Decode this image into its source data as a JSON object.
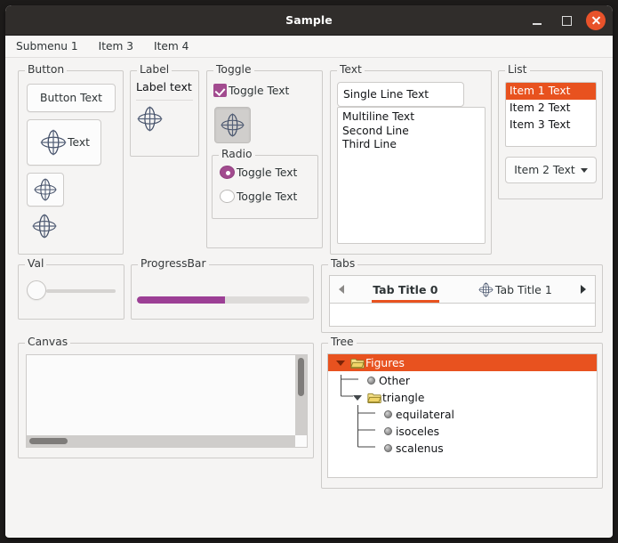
{
  "window": {
    "title": "Sample",
    "controls": {
      "minimize": "minimize",
      "maximize": "maximize",
      "close": "close"
    }
  },
  "menubar": {
    "items": [
      {
        "label": "Submenu 1"
      },
      {
        "label": "Item 3"
      },
      {
        "label": "Item 4"
      }
    ]
  },
  "colors": {
    "accent_orange": "#e8521f",
    "accent_purple": "#9c3f95",
    "checkbox_purple": "#a24b8f",
    "titlebar_bg": "#302d2b",
    "window_bg": "#f5f4f3",
    "border": "#cdcbc9",
    "folder_yellow": "#f2d86a"
  },
  "groups": {
    "button": {
      "legend": "Button",
      "buttons": [
        {
          "label": "Button Text",
          "icon": ""
        },
        {
          "label": "Text",
          "icon": "gyroscope-icon"
        },
        {
          "label": "",
          "icon": "gyroscope-icon"
        }
      ],
      "bare_icon": "gyroscope-icon"
    },
    "label": {
      "legend": "Label",
      "text": "Label text",
      "icon": "gyroscope-icon"
    },
    "toggle": {
      "legend": "Toggle",
      "checkbox": {
        "label": "Toggle Text",
        "checked": true
      },
      "toggle_button": {
        "icon": "gyroscope-icon",
        "pressed": true
      },
      "radio": {
        "legend": "Radio",
        "options": [
          {
            "label": "Toggle Text",
            "selected": true
          },
          {
            "label": "Toggle Text",
            "selected": false
          }
        ]
      }
    },
    "text": {
      "legend": "Text",
      "single_line": {
        "value": "Single Line Text",
        "placeholder": "Single Line Text"
      },
      "multiline": {
        "lines": [
          "Multiline Text",
          "Second Line",
          "Third Line"
        ],
        "value": "Multiline Text\nSecond Line\nThird Line"
      }
    },
    "list": {
      "legend": "List",
      "items": [
        {
          "label": "Item 1 Text",
          "selected": true
        },
        {
          "label": "Item 2 Text",
          "selected": false
        },
        {
          "label": "Item 3 Text",
          "selected": false
        }
      ],
      "combobox": {
        "selected": "Item 2 Text",
        "options": [
          "Item 1 Text",
          "Item 2 Text",
          "Item 3 Text"
        ]
      }
    },
    "val": {
      "legend": "Val",
      "slider": {
        "value": 0,
        "min": 0,
        "max": 100
      }
    },
    "progressbar": {
      "legend": "ProgressBar",
      "value": 51,
      "min": 0,
      "max": 100
    },
    "tabs": {
      "legend": "Tabs",
      "scroll_left": "scroll-left",
      "scroll_right": "scroll-right",
      "items": [
        {
          "label": "Tab Title 0",
          "active": true,
          "icon": ""
        },
        {
          "label": "Tab Title 1",
          "active": false,
          "icon": "gyroscope-icon"
        }
      ]
    },
    "canvas": {
      "legend": "Canvas",
      "vertical_scrollbar": "vertical-scrollbar",
      "horizontal_scrollbar": "horizontal-scrollbar"
    },
    "tree": {
      "legend": "Tree",
      "rows": [
        {
          "label": "Figures",
          "icon": "folder-open-icon",
          "expanded": true,
          "selected": true,
          "depth": 0
        },
        {
          "label": "Other",
          "icon": "sphere-icon",
          "expanded": null,
          "selected": false,
          "depth": 1
        },
        {
          "label": "triangle",
          "icon": "folder-open-icon",
          "expanded": true,
          "selected": false,
          "depth": 1
        },
        {
          "label": "equilateral",
          "icon": "sphere-icon",
          "expanded": null,
          "selected": false,
          "depth": 2
        },
        {
          "label": "isoceles",
          "icon": "sphere-icon",
          "expanded": null,
          "selected": false,
          "depth": 2
        },
        {
          "label": "scalenus",
          "icon": "sphere-icon",
          "expanded": null,
          "selected": false,
          "depth": 2
        }
      ]
    }
  }
}
